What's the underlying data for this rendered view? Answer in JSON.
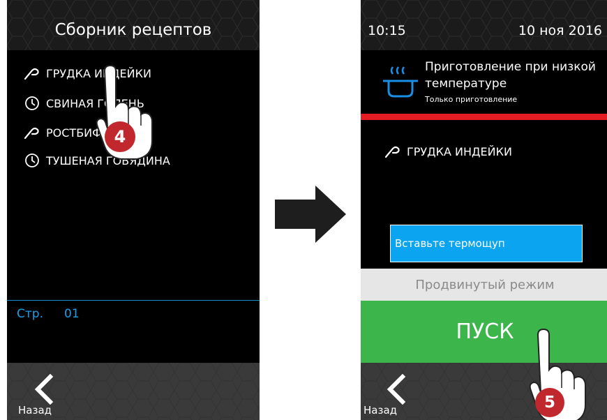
{
  "colors": {
    "background": "#000000",
    "accent_blue": "#1aa0e8",
    "start_green": "#3cb54a",
    "alert_red": "#e31b23",
    "probe_blue": "#0aa4f0",
    "step_badge": "#c0282d"
  },
  "left_screen": {
    "title": "Сборник рецептов",
    "recipes": [
      {
        "label": "ГРУДКА ИНДЕЙКИ",
        "icon": "probe-icon"
      },
      {
        "label": "СВИНАЯ ГОЛЕНЬ",
        "icon": "clock-icon"
      },
      {
        "label": "РОСТБИФ",
        "icon": "probe-icon"
      },
      {
        "label": "ТУШЕНАЯ ГОВЯДИНА",
        "icon": "clock-icon"
      }
    ],
    "page_label": "Стр.",
    "page_number": "01",
    "back_label": "Назад",
    "step_badge": "4"
  },
  "right_screen": {
    "time": "10:15",
    "date": "10 ноя 2016",
    "mode_title": "Приготовление при низкой температуре",
    "mode_subtitle": "Только приготовление",
    "selected_recipe": "ГРУДКА ИНДЕЙКИ",
    "probe_message": "Вставьте термощуп",
    "advanced_label": "Продвинутый режим",
    "start_label": "ПУСК",
    "back_label": "Назад",
    "step_badge": "5"
  }
}
